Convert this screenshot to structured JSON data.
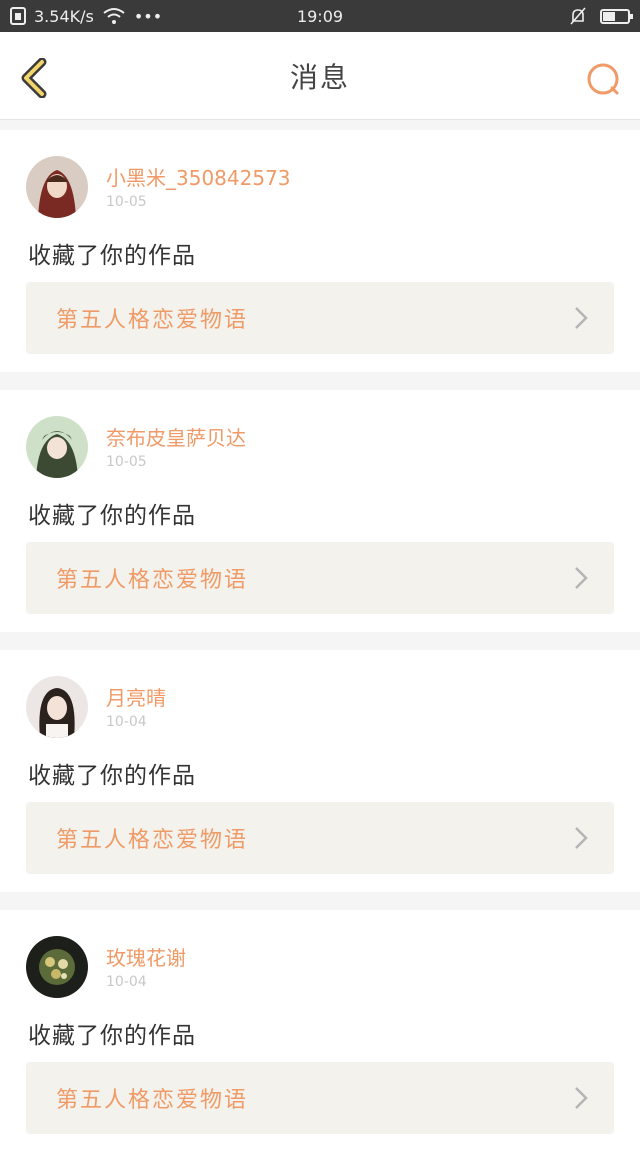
{
  "status_bar": {
    "net_speed": "3.54K/s",
    "time": "19:09",
    "more": "•••"
  },
  "header": {
    "title": "消息"
  },
  "accent_color": "#ef9a67",
  "messages": [
    {
      "username": "小黑米_350842573",
      "date": "10-05",
      "action": "收藏了你的作品",
      "work_title": "第五人格恋爱物语"
    },
    {
      "username": "奈布皮皇萨贝达",
      "date": "10-05",
      "action": "收藏了你的作品",
      "work_title": "第五人格恋爱物语"
    },
    {
      "username": "月亮晴",
      "date": "10-04",
      "action": "收藏了你的作品",
      "work_title": "第五人格恋爱物语"
    },
    {
      "username": "玫瑰花谢",
      "date": "10-04",
      "action": "收藏了你的作品",
      "work_title": "第五人格恋爱物语"
    }
  ]
}
